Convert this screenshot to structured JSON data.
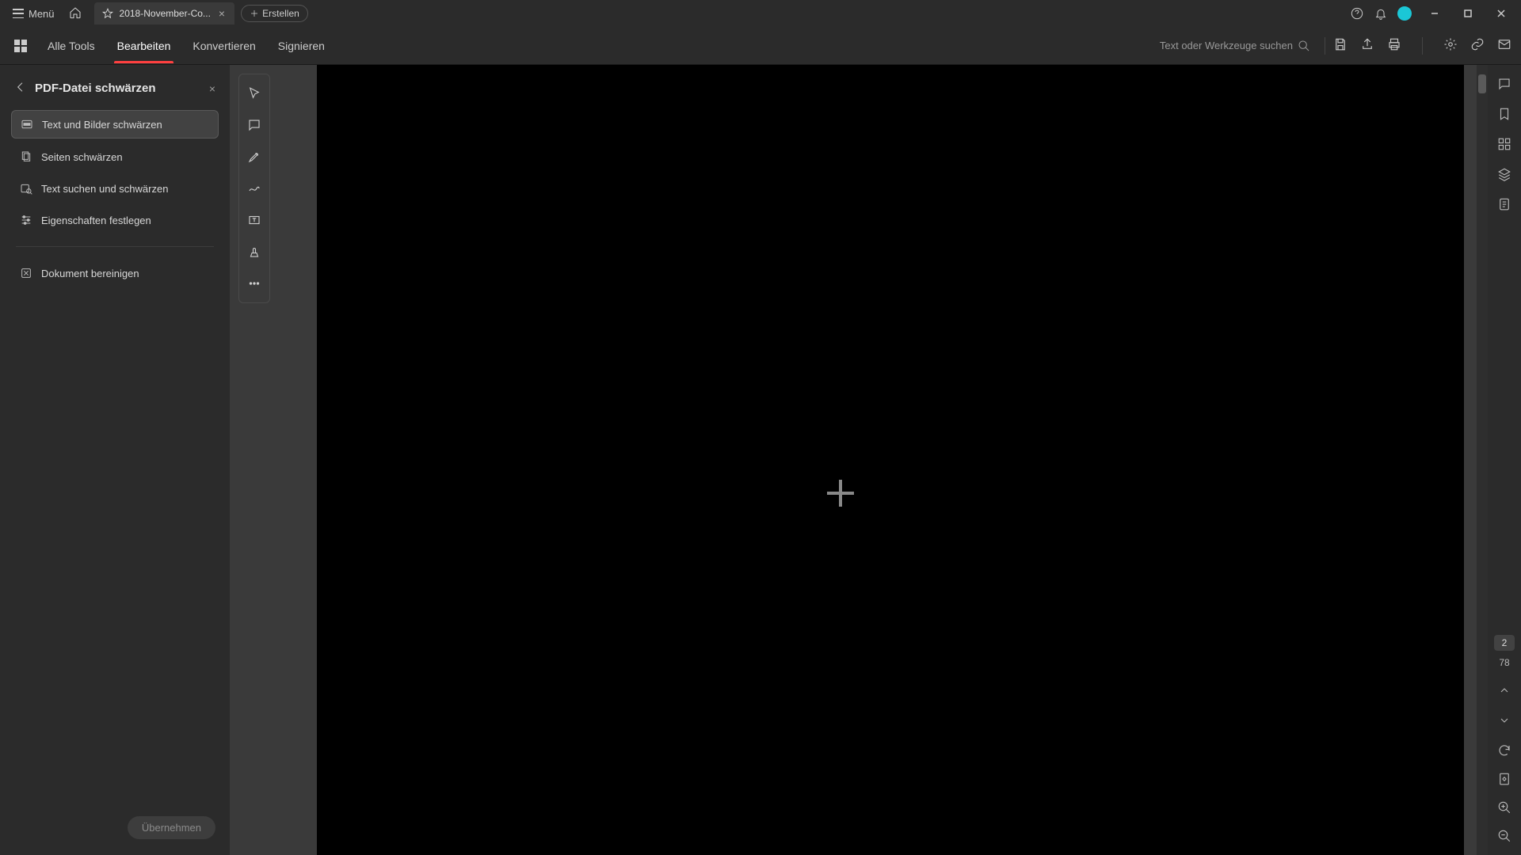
{
  "titlebar": {
    "menu_label": "Menü",
    "tab_label": "2018-November-Co...",
    "create_label": "Erstellen"
  },
  "topmenu": {
    "all_tools": "Alle Tools",
    "edit": "Bearbeiten",
    "convert": "Konvertieren",
    "sign": "Signieren",
    "search_placeholder": "Text oder Werkzeuge suchen"
  },
  "leftpanel": {
    "title": "PDF-Datei schwärzen",
    "items": [
      {
        "label": "Text und Bilder schwärzen"
      },
      {
        "label": "Seiten schwärzen"
      },
      {
        "label": "Text suchen und schwärzen"
      },
      {
        "label": "Eigenschaften festlegen"
      },
      {
        "label": "Dokument bereinigen"
      }
    ],
    "apply": "Übernehmen"
  },
  "pages": {
    "current": "2",
    "total": "78"
  }
}
